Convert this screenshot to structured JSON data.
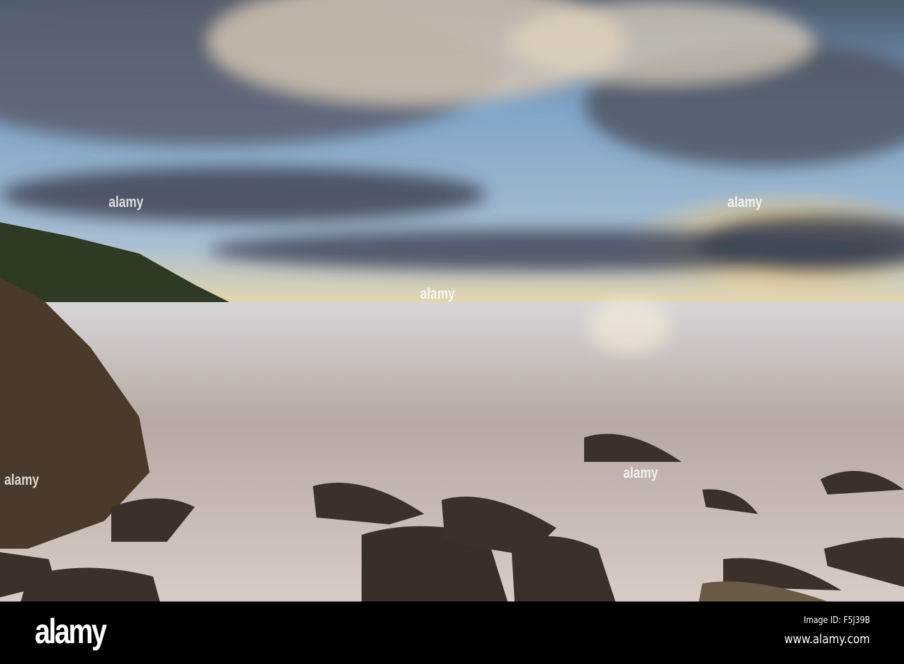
{
  "photo": {
    "subject": "Seascape at sunset",
    "colors": {
      "sky_blue": "#6f9cc4",
      "sun": "#f5d58a",
      "cloud": "#4a4f5e",
      "water": "#c9bcb4",
      "rock": "#3b302a"
    }
  },
  "footer": {
    "logo": "alamy",
    "image_id": "Image ID: F5J39B",
    "url": "www.alamy.com"
  },
  "watermark": "alamy"
}
